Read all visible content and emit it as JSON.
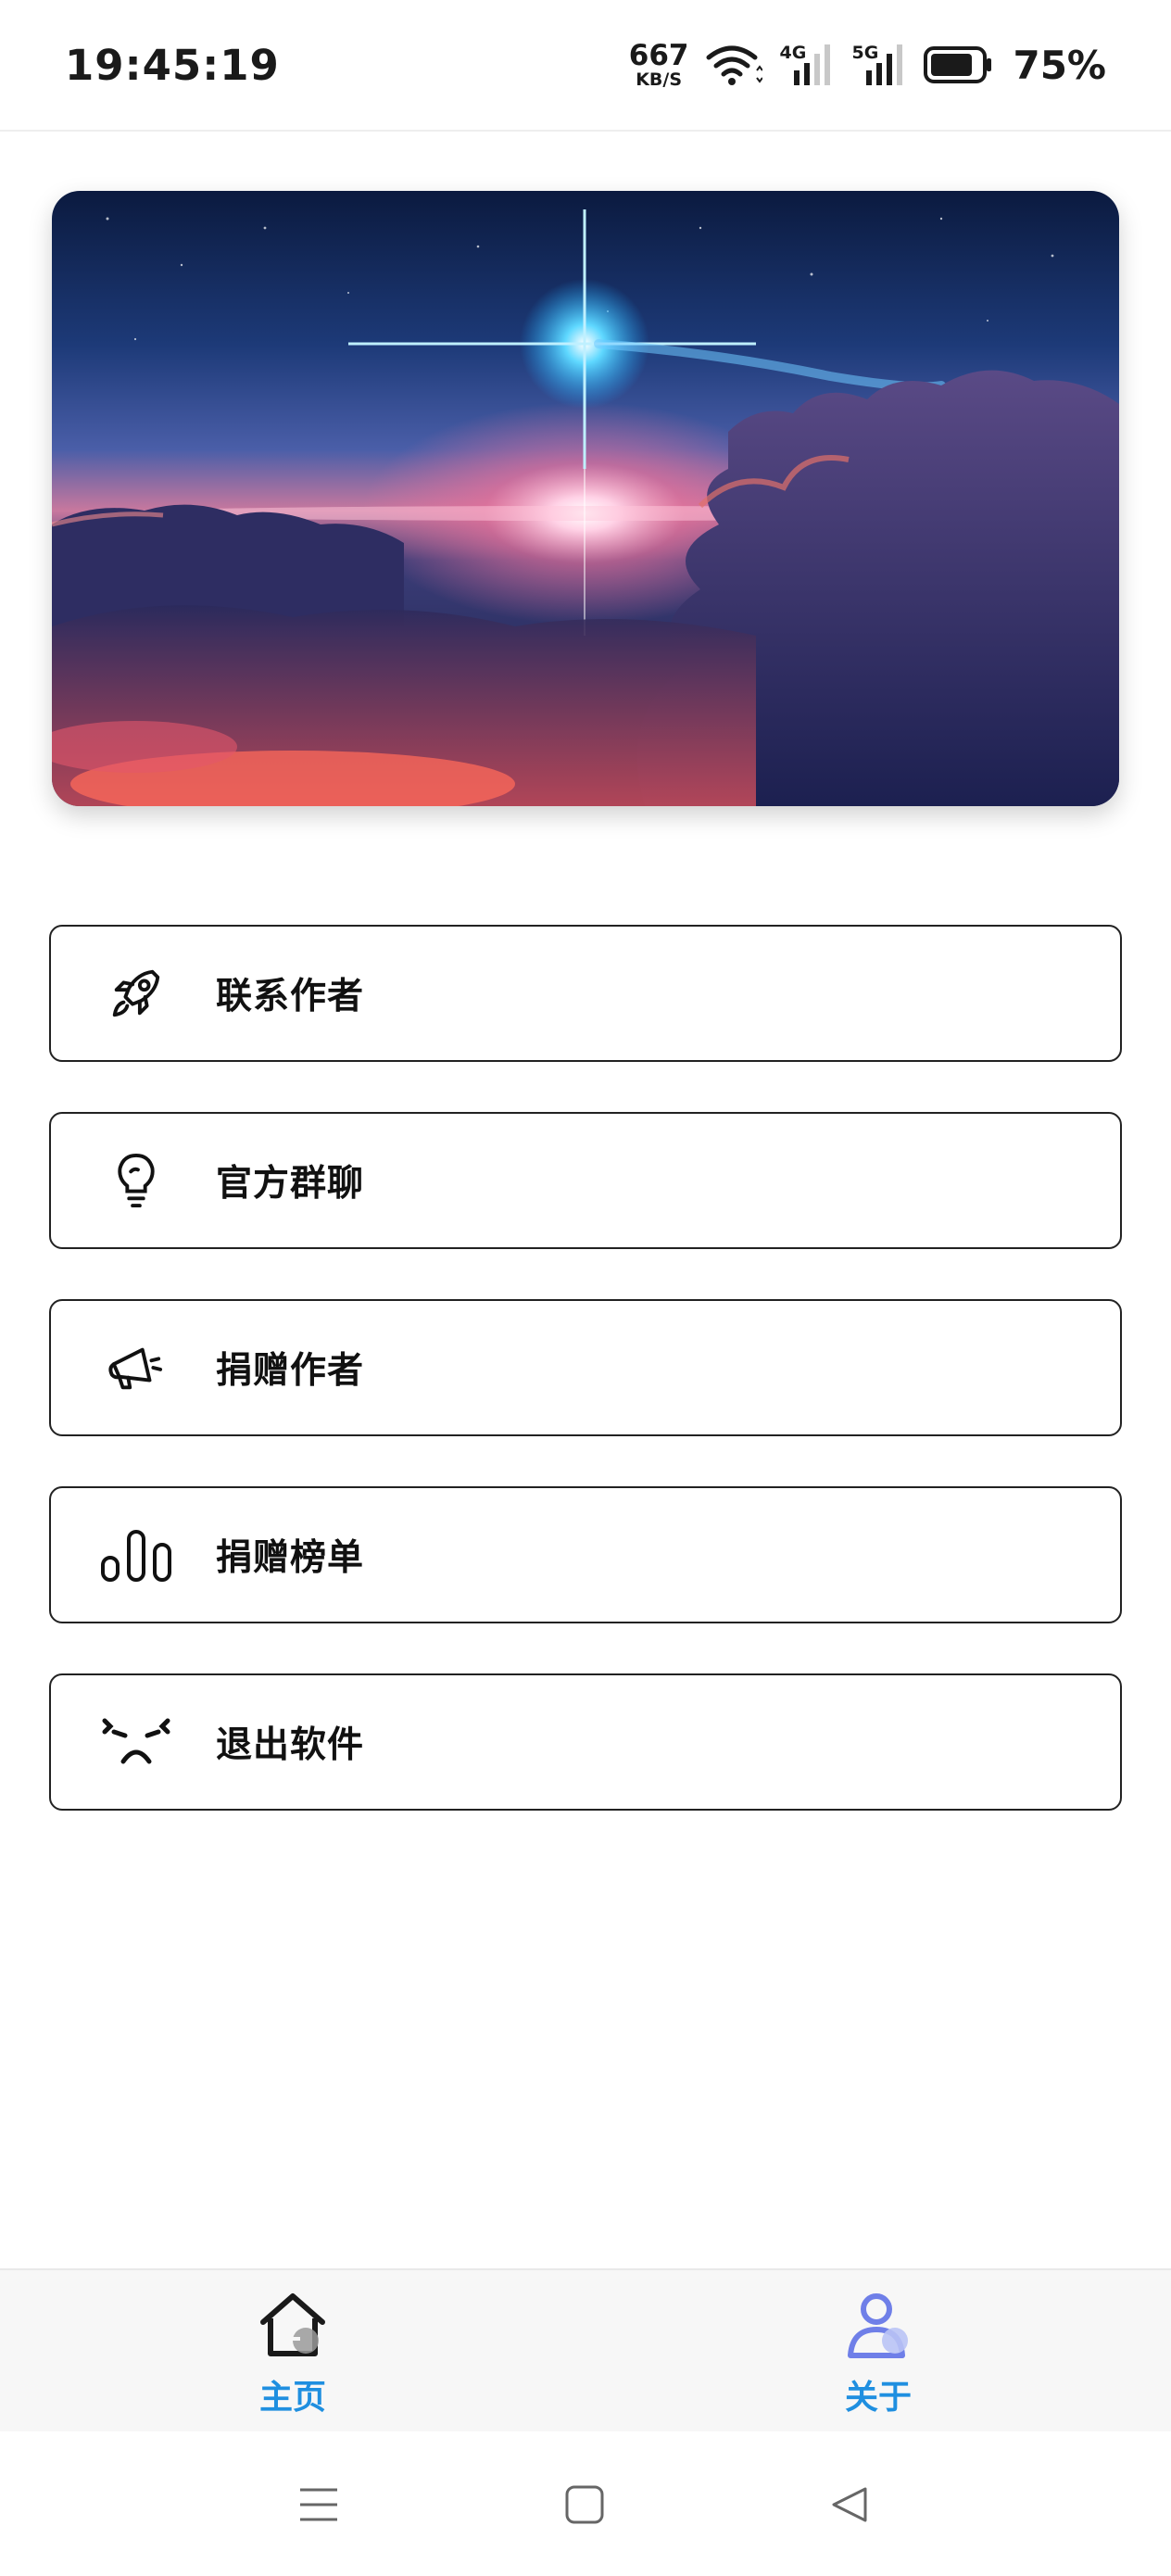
{
  "status_bar": {
    "time": "19:45:19",
    "net_speed_value": "667",
    "net_speed_unit": "KB/S",
    "signal1_label": "4G",
    "signal2_label": "5G",
    "battery_percent": "75%"
  },
  "menu": {
    "items": [
      {
        "label": "联系作者",
        "icon": "rocket-icon"
      },
      {
        "label": "官方群聊",
        "icon": "lightbulb-icon"
      },
      {
        "label": "捐赠作者",
        "icon": "megaphone-icon"
      },
      {
        "label": "捐赠榜单",
        "icon": "bar-chart-icon"
      },
      {
        "label": "退出软件",
        "icon": "angry-face-icon"
      }
    ]
  },
  "tab_bar": {
    "tabs": [
      {
        "label": "主页",
        "icon": "home-icon"
      },
      {
        "label": "关于",
        "icon": "user-icon"
      }
    ],
    "accent_color": "#1f8fe0"
  },
  "system_nav": {
    "buttons": [
      "menu-icon",
      "home-square-icon",
      "back-triangle-icon"
    ]
  }
}
